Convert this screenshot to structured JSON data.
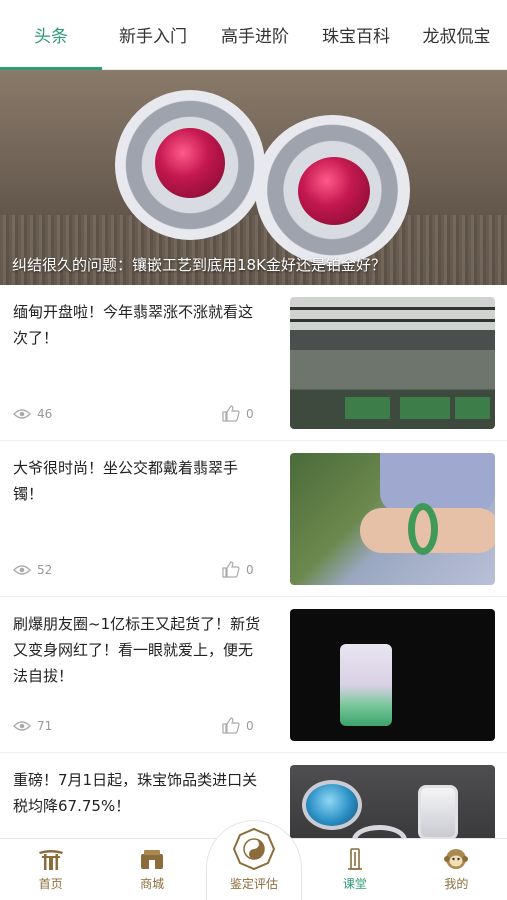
{
  "tabs": [
    {
      "label": "头条",
      "active": true
    },
    {
      "label": "新手入门",
      "active": false
    },
    {
      "label": "高手进阶",
      "active": false
    },
    {
      "label": "珠宝百科",
      "active": false
    },
    {
      "label": "龙叔侃宝",
      "active": false
    }
  ],
  "hero": {
    "caption": "纠结很久的问题：镶嵌工艺到底用18K金好还是铂金好？"
  },
  "feed": [
    {
      "title": "缅甸开盘啦！今年翡翠涨不涨就看这次了！",
      "views": "46",
      "likes": "0",
      "thumb_icon": "jade-market-photo"
    },
    {
      "title": "大爷很时尚！坐公交都戴着翡翠手镯！",
      "views": "52",
      "likes": "0",
      "thumb_icon": "jade-bangle-photo"
    },
    {
      "title": "刷爆朋友圈~1亿标王又起货了！新货又变身网红了！看一眼就爱上，便无法自拔！",
      "views": "71",
      "likes": "0",
      "thumb_icon": "jade-pendant-photo"
    },
    {
      "title": "重磅！7月1日起，珠宝饰品类进口关税均降67.75%！",
      "views": "",
      "likes": "",
      "thumb_icon": "gem-rings-photo"
    }
  ],
  "bottom_nav": {
    "home": "首页",
    "mall": "商城",
    "appraise": "鉴定评估",
    "classroom": "课堂",
    "mine": "我的"
  },
  "colors": {
    "accent": "#2e9b74",
    "nav_brown": "#8a6d3a",
    "meta_gray": "#999999"
  }
}
